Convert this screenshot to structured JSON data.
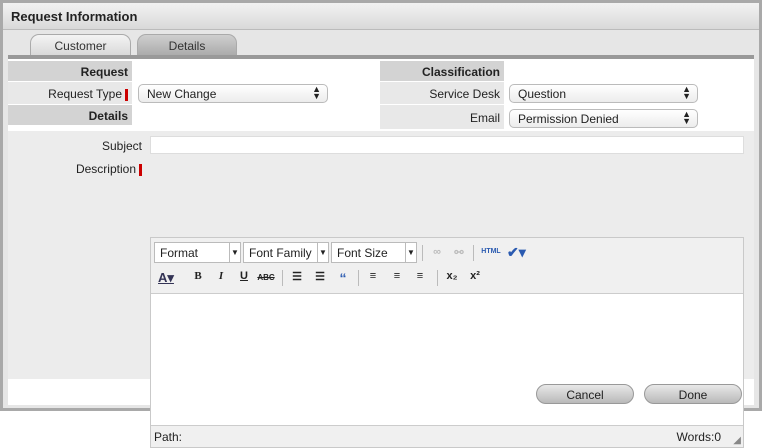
{
  "header": {
    "title": "Request Information"
  },
  "tabs": [
    {
      "label": "Customer"
    },
    {
      "label": "Details"
    }
  ],
  "request": {
    "section": "Request",
    "request_type_label": "Request Type",
    "request_type_value": "New Change",
    "details_section": "Details"
  },
  "classification": {
    "section": "Classification",
    "service_desk_label": "Service Desk",
    "service_desk_value": "Question",
    "email_label": "Email",
    "email_value": "Permission Denied"
  },
  "subject": {
    "label": "Subject",
    "value": ""
  },
  "description": {
    "label": "Description",
    "format": "Format",
    "font_family": "Font Family",
    "font_size": "Font Size",
    "html_label": "HTML",
    "path_label": "Path:",
    "words_label": "Words:0"
  },
  "buttons": {
    "cancel": "Cancel",
    "done": "Done"
  }
}
